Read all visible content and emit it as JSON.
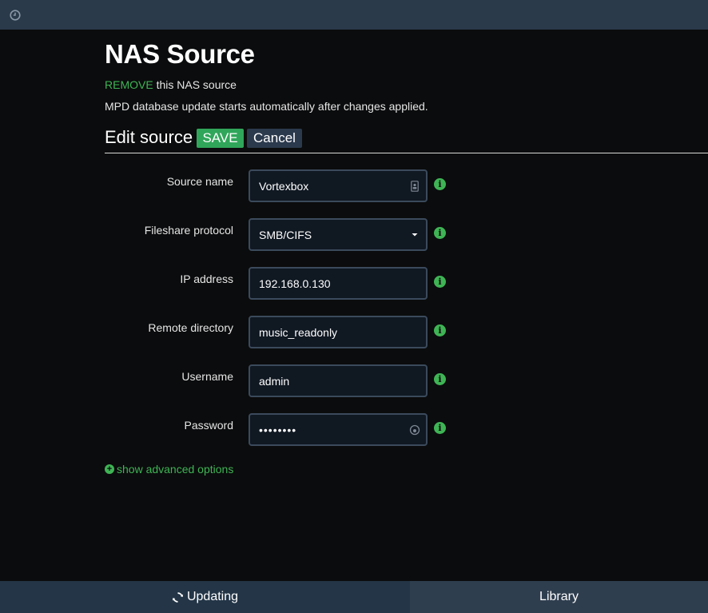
{
  "header": {
    "clock_icon": "clock-icon"
  },
  "page": {
    "title": "NAS Source",
    "remove_link": "REMOVE",
    "remove_suffix": " this NAS source",
    "note": "MPD database update starts automatically after changes applied."
  },
  "edit": {
    "title": "Edit source",
    "save_label": "SAVE",
    "cancel_label": "Cancel"
  },
  "form": {
    "source_name": {
      "label": "Source name",
      "value": "Vortexbox"
    },
    "protocol": {
      "label": "Fileshare protocol",
      "value": "SMB/CIFS"
    },
    "ip_address": {
      "label": "IP address",
      "value": "192.168.0.130"
    },
    "remote_directory": {
      "label": "Remote directory",
      "value": "music_readonly"
    },
    "username": {
      "label": "Username",
      "value": "admin"
    },
    "password": {
      "label": "Password",
      "value": "••••••••"
    }
  },
  "advanced_label": "show advanced options",
  "footer": {
    "updating_label": "Updating",
    "library_label": "Library"
  },
  "colors": {
    "accent_green": "#3fb455",
    "save_green": "#30a65a",
    "bar_blue": "#2a3a4b",
    "field_bg": "#101822",
    "field_border": "#3b4a5c"
  }
}
